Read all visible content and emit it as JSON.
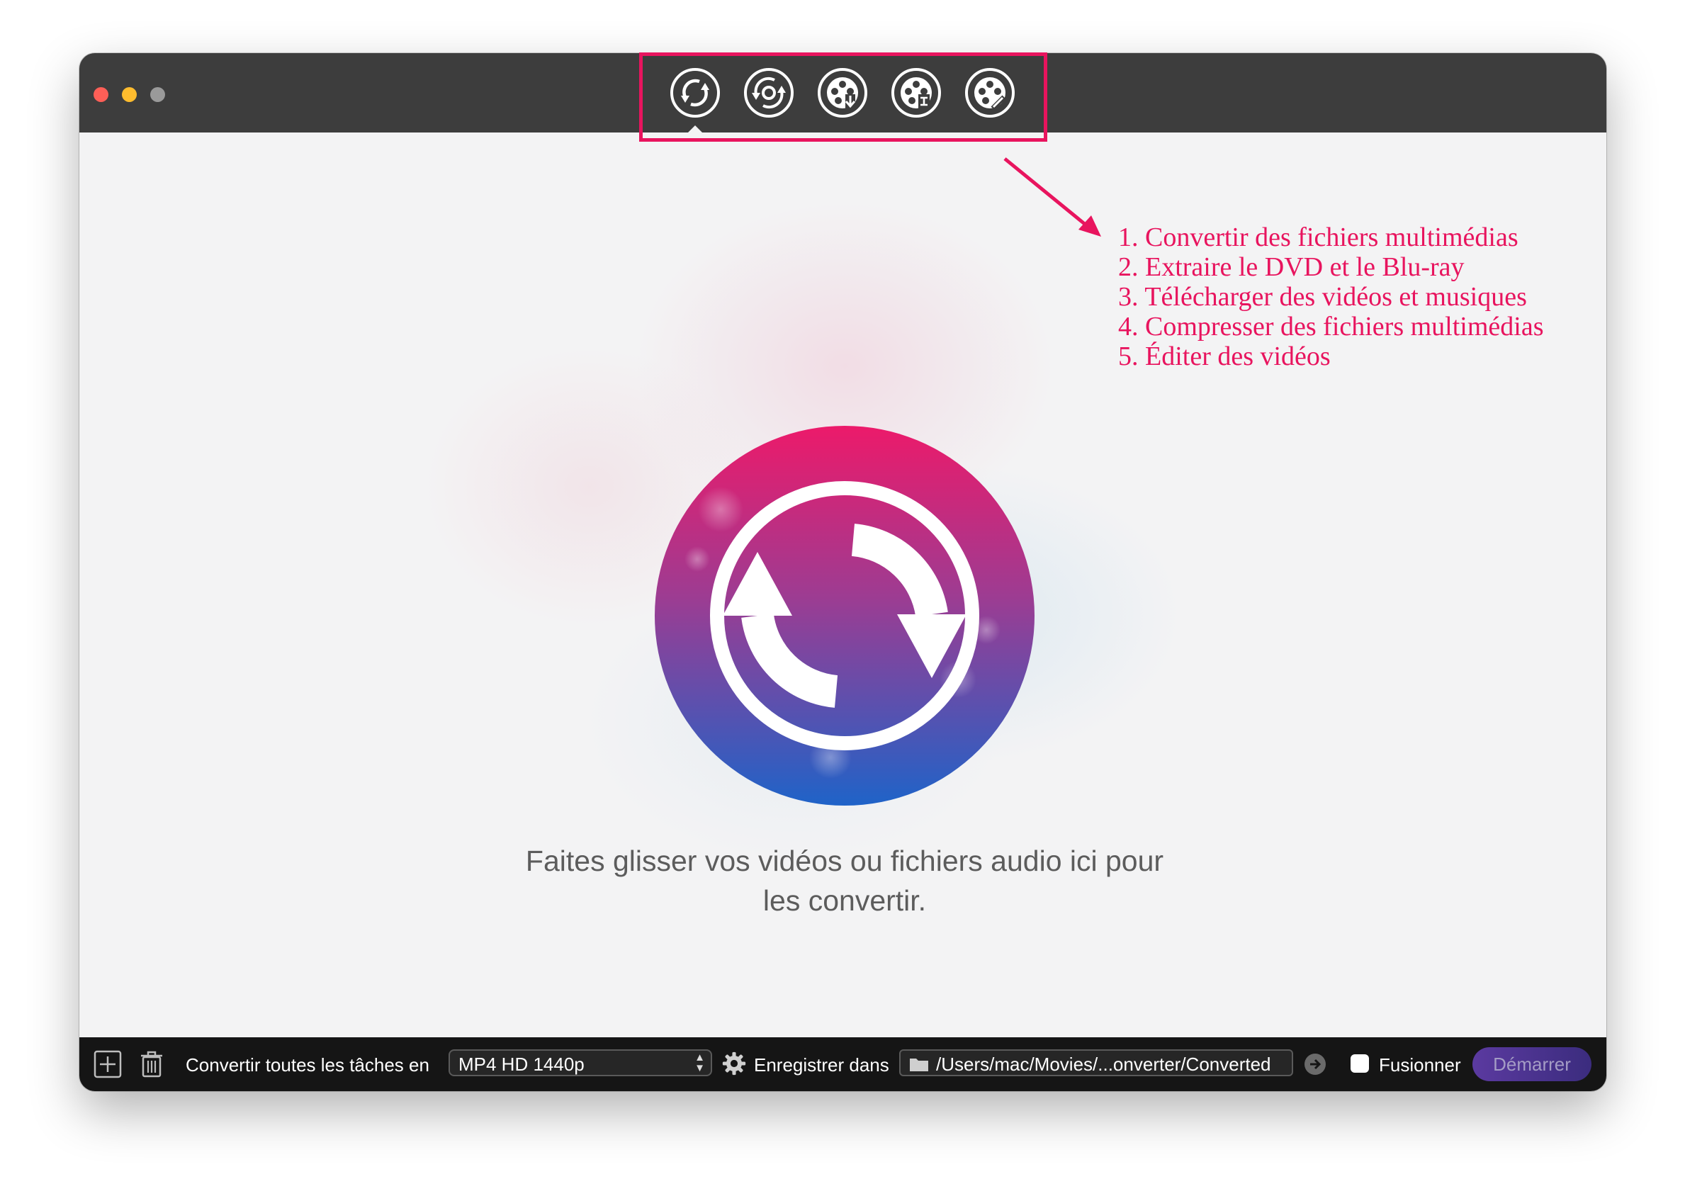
{
  "toolbar": {
    "tools": [
      {
        "icon": "convert-icon"
      },
      {
        "icon": "dvd-rip-icon"
      },
      {
        "icon": "download-icon"
      },
      {
        "icon": "compress-icon"
      },
      {
        "icon": "edit-icon"
      }
    ]
  },
  "main": {
    "hero_icon": "convert-icon",
    "drop_line1": "Faites glisser vos vidéos ou fichiers audio ici pour",
    "drop_line2": "les convertir."
  },
  "bottom_bar": {
    "add_icon": "plus-icon",
    "delete_icon": "trash-icon",
    "convert_all_label": "Convertir toutes les tâches en",
    "format_value": "MP4 HD 1440p",
    "settings_icon": "gear-icon",
    "save_in_label": "Enregistrer dans",
    "output_path": "/Users/mac/Movies/...onverter/Converted",
    "open_folder_icon": "arrow-right-circle-icon",
    "merge_label": "Fusionner",
    "merge_checked": false,
    "start_label": "Démarrer"
  },
  "annotation": {
    "items": [
      "1. Convertir des fichiers multimédias",
      "2. Extraire le DVD et le Blu-ray",
      "3. Télécharger des vidéos et musiques",
      "4. Compresser des fichiers multimédias",
      "5. Éditer des vidéos"
    ]
  },
  "colors": {
    "annotation": "#e8145e",
    "titlebar": "#3d3d3d",
    "bottom_bar": "#151515",
    "start_button": "#4a3390"
  }
}
